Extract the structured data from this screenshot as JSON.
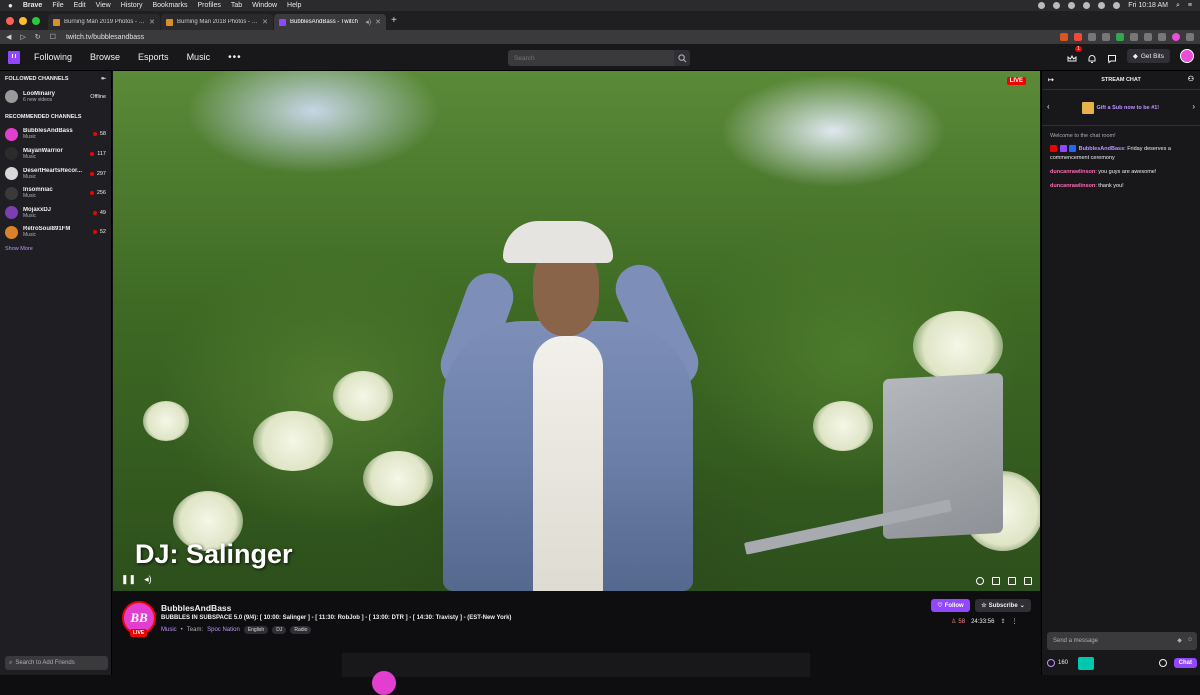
{
  "menubar": {
    "items": [
      "Brave",
      "File",
      "Edit",
      "View",
      "History",
      "Bookmarks",
      "Profiles",
      "Tab",
      "Window",
      "Help"
    ],
    "clock": "Fri 10:18 AM"
  },
  "browser": {
    "tabs": [
      {
        "label": "Burning Man 2019 Photos - Durn"
      },
      {
        "label": "Burning Man 2018 Photos - Durn"
      },
      {
        "label": "BubblesAndBass - Twitch"
      }
    ],
    "url": "twitch.tv/bubblesandbass"
  },
  "topnav": {
    "links": [
      "Following",
      "Browse",
      "Esports",
      "Music"
    ],
    "more": "•••",
    "search_placeholder": "Search",
    "notif_count": "1",
    "get_bits": "Get Bits"
  },
  "sidebar": {
    "followed_title": "FOLLOWED CHANNELS",
    "followed": [
      {
        "name": "LooMinairy",
        "sub": "6 new videos",
        "status": "Offline"
      }
    ],
    "recommended_title": "RECOMMENDED CHANNELS",
    "recommended": [
      {
        "name": "BubblesAndBass",
        "sub": "Music",
        "viewers": "58",
        "color": "#e23fd0"
      },
      {
        "name": "MayanWarrior",
        "sub": "Music",
        "viewers": "117",
        "color": "#2b2b2b"
      },
      {
        "name": "DesertHeartsRecor...",
        "sub": "Music",
        "viewers": "297",
        "color": "#d8d8d8"
      },
      {
        "name": "Insomniac",
        "sub": "Music",
        "viewers": "256",
        "color": "#3a3a3a"
      },
      {
        "name": "MojaxxDJ",
        "sub": "Music",
        "viewers": "49",
        "color": "#7a3fb0"
      },
      {
        "name": "RetroSoul891FM",
        "sub": "Music",
        "viewers": "52",
        "color": "#d9822b"
      }
    ],
    "show_more": "Show More",
    "friends_placeholder": "Search to Add Friends"
  },
  "player": {
    "caption": "DJ: Salinger",
    "live": "LIVE"
  },
  "channel": {
    "avatar_text": "BB",
    "live": "LIVE",
    "name": "BubblesAndBass",
    "title": "BUBBLES IN SUBSPACE 5.0 (9/4): [ 10:00: Salinger ] - [ 11:30: RobJob ] - [ 13:00: DTR ] - [ 14:30: Travisty ] - (EST-New York)",
    "category": "Music",
    "team_label": "Team:",
    "team": "Spoc Nation",
    "tags": [
      "English",
      "DJ",
      "Radio"
    ],
    "follow": "Follow",
    "subscribe": "Subscribe",
    "viewers": "58",
    "uptime": "24:33:56"
  },
  "chat": {
    "title": "STREAM CHAT",
    "gift_text": "Gift a Sub now to be #1!",
    "welcome": "Welcome to the chat room!",
    "messages": [
      {
        "user": "BubblesAndBass",
        "text": ": Friday deserves a commencement ceremony"
      },
      {
        "user": "duncanrawlinson",
        "text": ": you guys are awesome!"
      },
      {
        "user": "duncanrawlinson",
        "text": ": thank you!"
      }
    ],
    "input_placeholder": "Send a message",
    "points": "160",
    "chat_button": "Chat"
  }
}
